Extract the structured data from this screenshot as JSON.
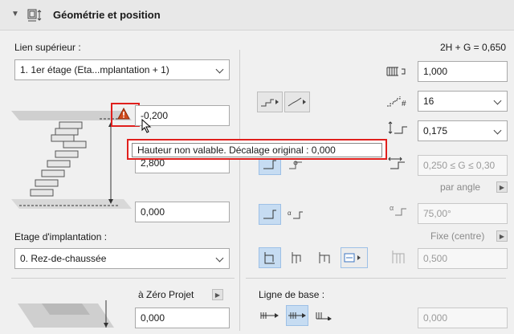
{
  "header": {
    "title": "Géométrie et position",
    "icon": "stair-geometry-icon"
  },
  "left": {
    "top_link_label": "Lien supérieur :",
    "top_link_value": "1. 1er étage (Eta...mplantation + 1)",
    "top_offset_value": "-0,200",
    "height_value": "2,800",
    "base_offset_value": "0,000",
    "home_story_label": "Etage d'implantation :",
    "home_story_value": "0. Rez-de-chaussée",
    "zero_label": "à Zéro Projet",
    "zero_value": "0,000"
  },
  "tooltip": {
    "text": "Hauteur non valable. Décalage original : 0,000"
  },
  "right": {
    "formula": "2H + G = 0,650",
    "width_value": "1,000",
    "risers_value": "16",
    "riser_height_value": "0,175",
    "going_value": "0,250 ≤ G ≤ 0,30",
    "by_angle_label": "par angle",
    "angle_value": "75,00°",
    "fixed_label": "Fixe (centre)",
    "offset_value": "0,500",
    "baseline_label": "Ligne de base :",
    "baseline_value": "0,000"
  },
  "colors": {
    "accent": "#c6dcf2",
    "warning": "#e0201d"
  }
}
